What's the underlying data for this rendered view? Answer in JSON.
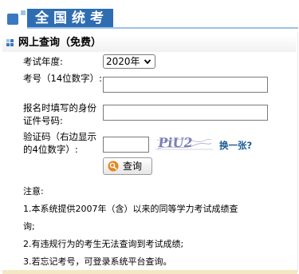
{
  "header": {
    "title": "全国统考"
  },
  "section": {
    "title": "网上查询（免费）"
  },
  "form": {
    "year_label": "考试年度:",
    "year_value": "2020年",
    "exam_no_label": "考号（14位数字）:",
    "id_label": "报名时填写的身份证件号码:",
    "code_label": "验证码（右边显示的4位数字）:",
    "captcha_text": "PiU2",
    "refresh_link": "换一张?",
    "query_button": "查询"
  },
  "notes": {
    "title": "注意:",
    "line1a": "1.本系统提供2007年（含）以来的同等学力考试成绩查",
    "line1b": "询;",
    "line2": "2.有违规行为的考生无法查询到考试成绩;",
    "line3": "3.若忘记考号，可登录系统平台查询。"
  },
  "icons": {
    "header_square": "blue-square-icon",
    "section_icon": "four-squares-icon",
    "select_chevron": "chevron-down-icon",
    "query_icon": "search-icon"
  },
  "colors": {
    "header_bar": "#2f6db3",
    "accent_blue": "#3b78c2",
    "link": "#1a5b96",
    "bottom_bar": "#f4e7c4"
  }
}
